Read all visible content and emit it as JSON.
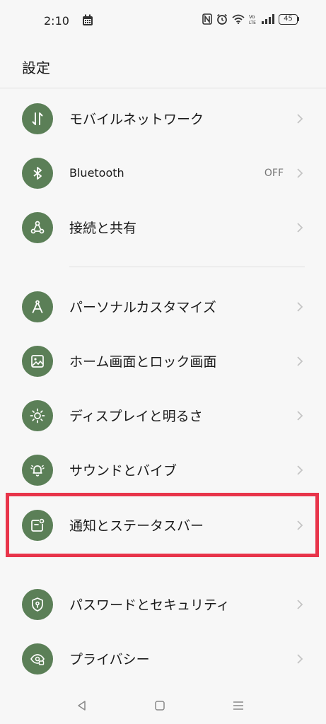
{
  "status_bar": {
    "time": "2:10",
    "battery": "45",
    "icons": [
      "calendar-icon",
      "nfc-icon",
      "alarm-icon",
      "wifi-icon",
      "volte-icon",
      "signal-icon",
      "battery-icon"
    ]
  },
  "header": {
    "title": "設定"
  },
  "rows": [
    {
      "label": "モバイルネットワーク",
      "icon": "mobile-data-icon"
    },
    {
      "label": "Bluetooth",
      "value": "OFF",
      "icon": "bluetooth-icon"
    },
    {
      "label": "接続と共有",
      "icon": "connection-share-icon"
    },
    {
      "label": "パーソナルカスタマイズ",
      "icon": "personalization-icon"
    },
    {
      "label": "ホーム画面とロック画面",
      "icon": "wallpaper-icon"
    },
    {
      "label": "ディスプレイと明るさ",
      "icon": "brightness-icon"
    },
    {
      "label": "サウンドとバイブ",
      "icon": "bell-icon"
    },
    {
      "label": "通知とステータスバー",
      "icon": "notification-icon"
    },
    {
      "label": "パスワードとセキュリティ",
      "icon": "shield-lock-icon"
    },
    {
      "label": "プライバシー",
      "icon": "privacy-eye-icon"
    }
  ],
  "colors": {
    "icon_background": "#5b7f57",
    "highlight": "#e8344a",
    "background": "#f7f7f7"
  },
  "nav": [
    "back-icon",
    "home-icon",
    "recents-icon"
  ]
}
